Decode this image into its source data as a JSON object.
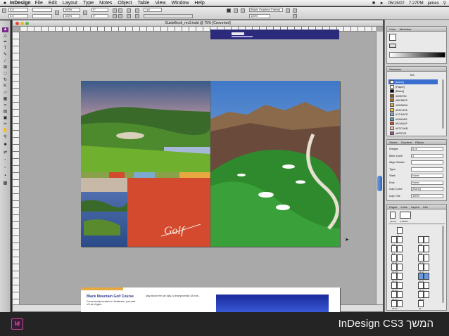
{
  "menubar": {
    "apple": "",
    "app": "InDesign",
    "items": [
      "File",
      "Edit",
      "Layout",
      "Type",
      "Notes",
      "Object",
      "Table",
      "View",
      "Window",
      "Help"
    ],
    "date": "05/15/07",
    "time": "7:27PM",
    "user": "james"
  },
  "control": {
    "x": "0.0 ",
    "y": "0.0 ",
    "w": "",
    "h": "",
    "zoom1": "100%",
    "zoom2": "100%",
    "rot": "0°",
    "shear": "0°",
    "stroke_weight": "1 pt",
    "font": "[Basic Graphics Frame]",
    "opacity": "100%"
  },
  "document": {
    "title": "GuideBook_rev3.indd @ 75% [Converted]"
  },
  "page2": {
    "heading": "Black Mountain Golf Course",
    "body": "Conveniently located in Henderson, just east of Las Vegas...",
    "body2": "play above the par play, a championship 18 hole..."
  },
  "panels": {
    "color_tabs": [
      "Color",
      "Attributes"
    ],
    "swatches_tabs": [
      "Swatches"
    ],
    "swatches_tint": "Tint:",
    "swatches": [
      "[None]",
      "[Paper]",
      "[Black]",
      "#895706",
      "#BC6825",
      "#D8A65A",
      "#FAC435",
      "#7CA9CE",
      "#5A9AB2",
      "#D34A2F",
      "#F2C4AB",
      "#8F5781"
    ],
    "swatch_colors": [
      "#ffffff",
      "#ffffff",
      "#000000",
      "#895706",
      "#BC6825",
      "#D8A65A",
      "#FAC435",
      "#7CA9CE",
      "#5A9AB2",
      "#D34A2F",
      "#F2C4AB",
      "#8F5781"
    ],
    "stroke_tabs": [
      "Stroke",
      "Gradient",
      "Effects"
    ],
    "stroke_rows": [
      "Weight:",
      "Miter Limit:",
      "Align Stroke:",
      "Type:",
      "Start:",
      "End:",
      "Gap Color:",
      "Gap Tint:"
    ],
    "stroke_values": [
      "0 pt",
      "4",
      "",
      "",
      "None",
      "None",
      "[None]",
      "100%"
    ],
    "pages_tabs": [
      "Pages",
      "Links",
      "Layers",
      "Info"
    ],
    "master_labels": [
      "[None]",
      "A-Master"
    ],
    "page_labels": [
      "1",
      "2-3",
      "4-5",
      "6-7",
      "8-9",
      "10-11",
      "12-13",
      "14-15",
      "16-17",
      "18-19",
      "20-21",
      "22-23",
      "24-25",
      "26-27",
      "28-29",
      "30-31",
      "32"
    ]
  },
  "caption": {
    "logo": "Id",
    "text": "InDesign CS3 המשך"
  }
}
